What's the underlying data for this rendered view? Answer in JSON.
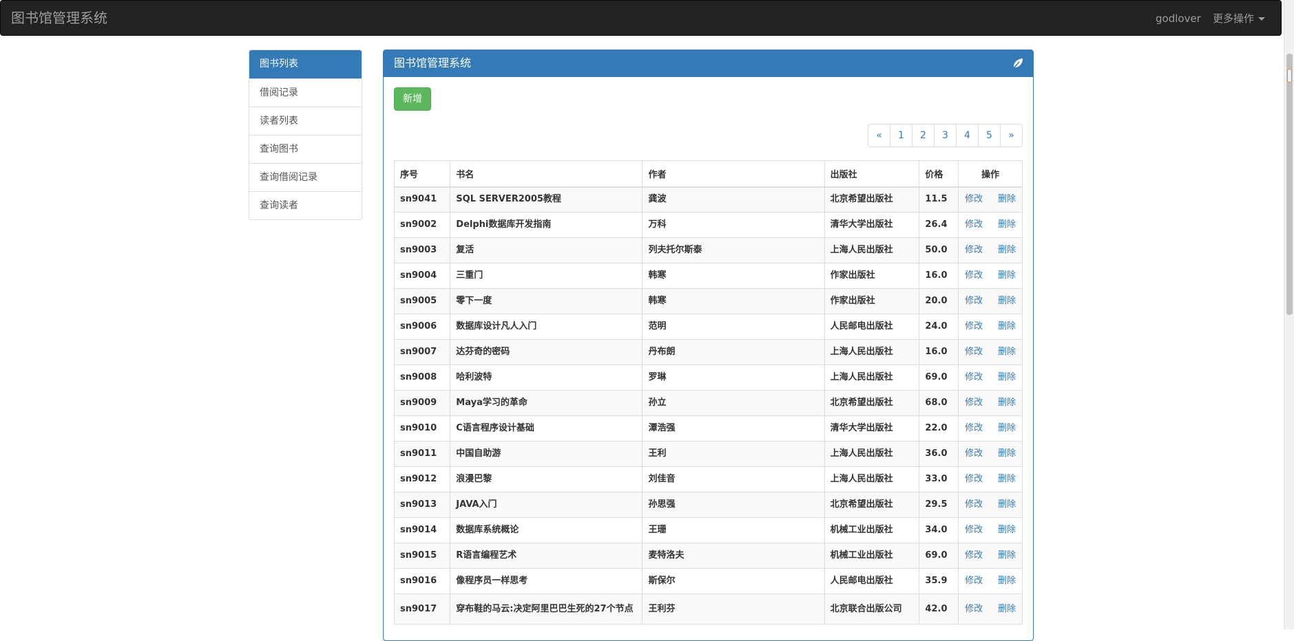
{
  "navbar": {
    "brand": "图书馆管理系统",
    "user": "godlover",
    "more": "更多操作"
  },
  "sidebar": {
    "items": [
      {
        "label": "图书列表",
        "active": true
      },
      {
        "label": "借阅记录",
        "active": false
      },
      {
        "label": "读者列表",
        "active": false
      },
      {
        "label": "查询图书",
        "active": false
      },
      {
        "label": "查询借阅记录",
        "active": false
      },
      {
        "label": "查询读者",
        "active": false
      }
    ]
  },
  "panel": {
    "title": "图书馆管理系统",
    "icon": "leaf-icon",
    "add_label": "新增"
  },
  "pagination": [
    "«",
    "1",
    "2",
    "3",
    "4",
    "5",
    "»"
  ],
  "table": {
    "headers": [
      "序号",
      "书名",
      "作者",
      "出版社",
      "价格",
      "操作"
    ],
    "edit_label": "修改",
    "delete_label": "删除",
    "rows": [
      [
        "sn9041",
        "SQL SERVER2005教程",
        "龚波",
        "北京希望出版社",
        "11.5"
      ],
      [
        "sn9002",
        "Delphi数据库开发指南",
        "万科",
        "清华大学出版社",
        "26.4"
      ],
      [
        "sn9003",
        "复活",
        "列夫托尔斯泰",
        "上海人民出版社",
        "50.0"
      ],
      [
        "sn9004",
        "三重门",
        "韩寒",
        "作家出版社",
        "16.0"
      ],
      [
        "sn9005",
        "零下一度",
        "韩寒",
        "作家出版社",
        "20.0"
      ],
      [
        "sn9006",
        "数据库设计凡人入门",
        "范明",
        "人民邮电出版社",
        "24.0"
      ],
      [
        "sn9007",
        "达芬奇的密码",
        "丹布朗",
        "上海人民出版社",
        "16.0"
      ],
      [
        "sn9008",
        "哈利波特",
        "罗琳",
        "上海人民出版社",
        "69.0"
      ],
      [
        "sn9009",
        "Maya学习的革命",
        "孙立",
        "北京希望出版社",
        "68.0"
      ],
      [
        "sn9010",
        "C语言程序设计基础",
        "潭浩强",
        "清华大学出版社",
        "22.0"
      ],
      [
        "sn9011",
        "中国自助游",
        "王利",
        "上海人民出版社",
        "36.0"
      ],
      [
        "sn9012",
        "浪漫巴黎",
        "刘佳音",
        "上海人民出版社",
        "33.0"
      ],
      [
        "sn9013",
        "JAVA入门",
        "孙思强",
        "北京希望出版社",
        "29.5"
      ],
      [
        "sn9014",
        "数据库系统概论",
        "王珊",
        "机械工业出版社",
        "34.0"
      ],
      [
        "sn9015",
        "R语言编程艺术",
        "麦特洛夫",
        "机械工业出版社",
        "69.0"
      ],
      [
        "sn9016",
        "像程序员一样思考",
        "斯保尔",
        "人民邮电出版社",
        "35.9"
      ],
      [
        "sn9017",
        "穿布鞋的马云:决定阿里巴巴生死的27个节点",
        "王利芬",
        "北京联合出版公司",
        "42.0"
      ]
    ]
  }
}
